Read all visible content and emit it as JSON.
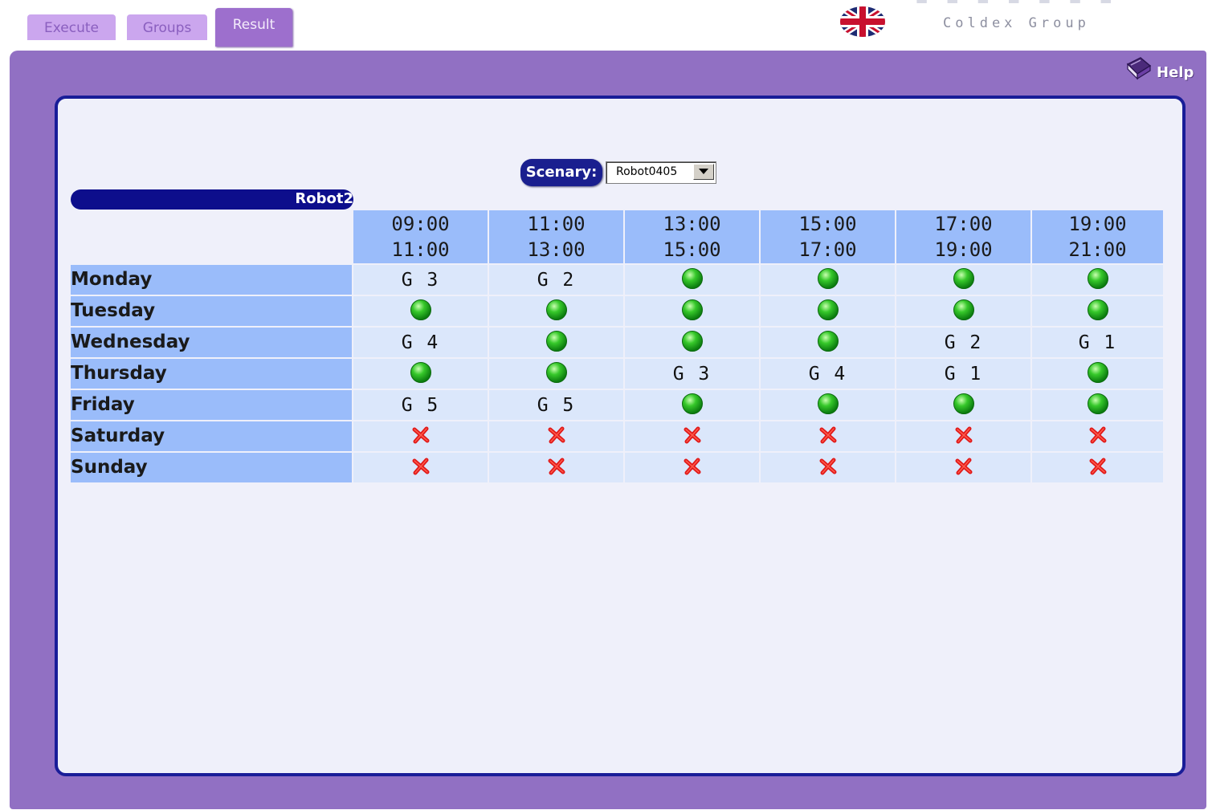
{
  "tabs": [
    {
      "label": "Execute",
      "active": false
    },
    {
      "label": "Groups",
      "active": false
    },
    {
      "label": "Result",
      "active": true
    }
  ],
  "logo": {
    "text": "Coldex Group",
    "icon": "union-flag-icon"
  },
  "help": {
    "label": "Help",
    "icon": "book-icon"
  },
  "scenary": {
    "label": "Scenary:",
    "selected": "Robot0405"
  },
  "robot": {
    "name": "Robot2"
  },
  "colors": {
    "frame": "#9170c3",
    "panel_border": "#191d98",
    "header_cell": "#9abcfa",
    "body_cell": "#dbe7fb",
    "available": "#22b01e",
    "unavailable": "#e01818"
  },
  "schedule": {
    "slots": [
      {
        "start": "09:00",
        "end": "11:00"
      },
      {
        "start": "11:00",
        "end": "13:00"
      },
      {
        "start": "13:00",
        "end": "15:00"
      },
      {
        "start": "15:00",
        "end": "17:00"
      },
      {
        "start": "17:00",
        "end": "19:00"
      },
      {
        "start": "19:00",
        "end": "21:00"
      }
    ],
    "days": [
      {
        "name": "Monday",
        "cells": [
          "G 3",
          "G 2",
          "available",
          "available",
          "available",
          "available"
        ]
      },
      {
        "name": "Tuesday",
        "cells": [
          "available",
          "available",
          "available",
          "available",
          "available",
          "available"
        ]
      },
      {
        "name": "Wednesday",
        "cells": [
          "G 4",
          "available",
          "available",
          "available",
          "G 2",
          "G 1"
        ]
      },
      {
        "name": "Thursday",
        "cells": [
          "available",
          "available",
          "G 3",
          "G 4",
          "G 1",
          "available"
        ]
      },
      {
        "name": "Friday",
        "cells": [
          "G 5",
          "G 5",
          "available",
          "available",
          "available",
          "available"
        ]
      },
      {
        "name": "Saturday",
        "cells": [
          "unavailable",
          "unavailable",
          "unavailable",
          "unavailable",
          "unavailable",
          "unavailable"
        ]
      },
      {
        "name": "Sunday",
        "cells": [
          "unavailable",
          "unavailable",
          "unavailable",
          "unavailable",
          "unavailable",
          "unavailable"
        ]
      }
    ]
  }
}
